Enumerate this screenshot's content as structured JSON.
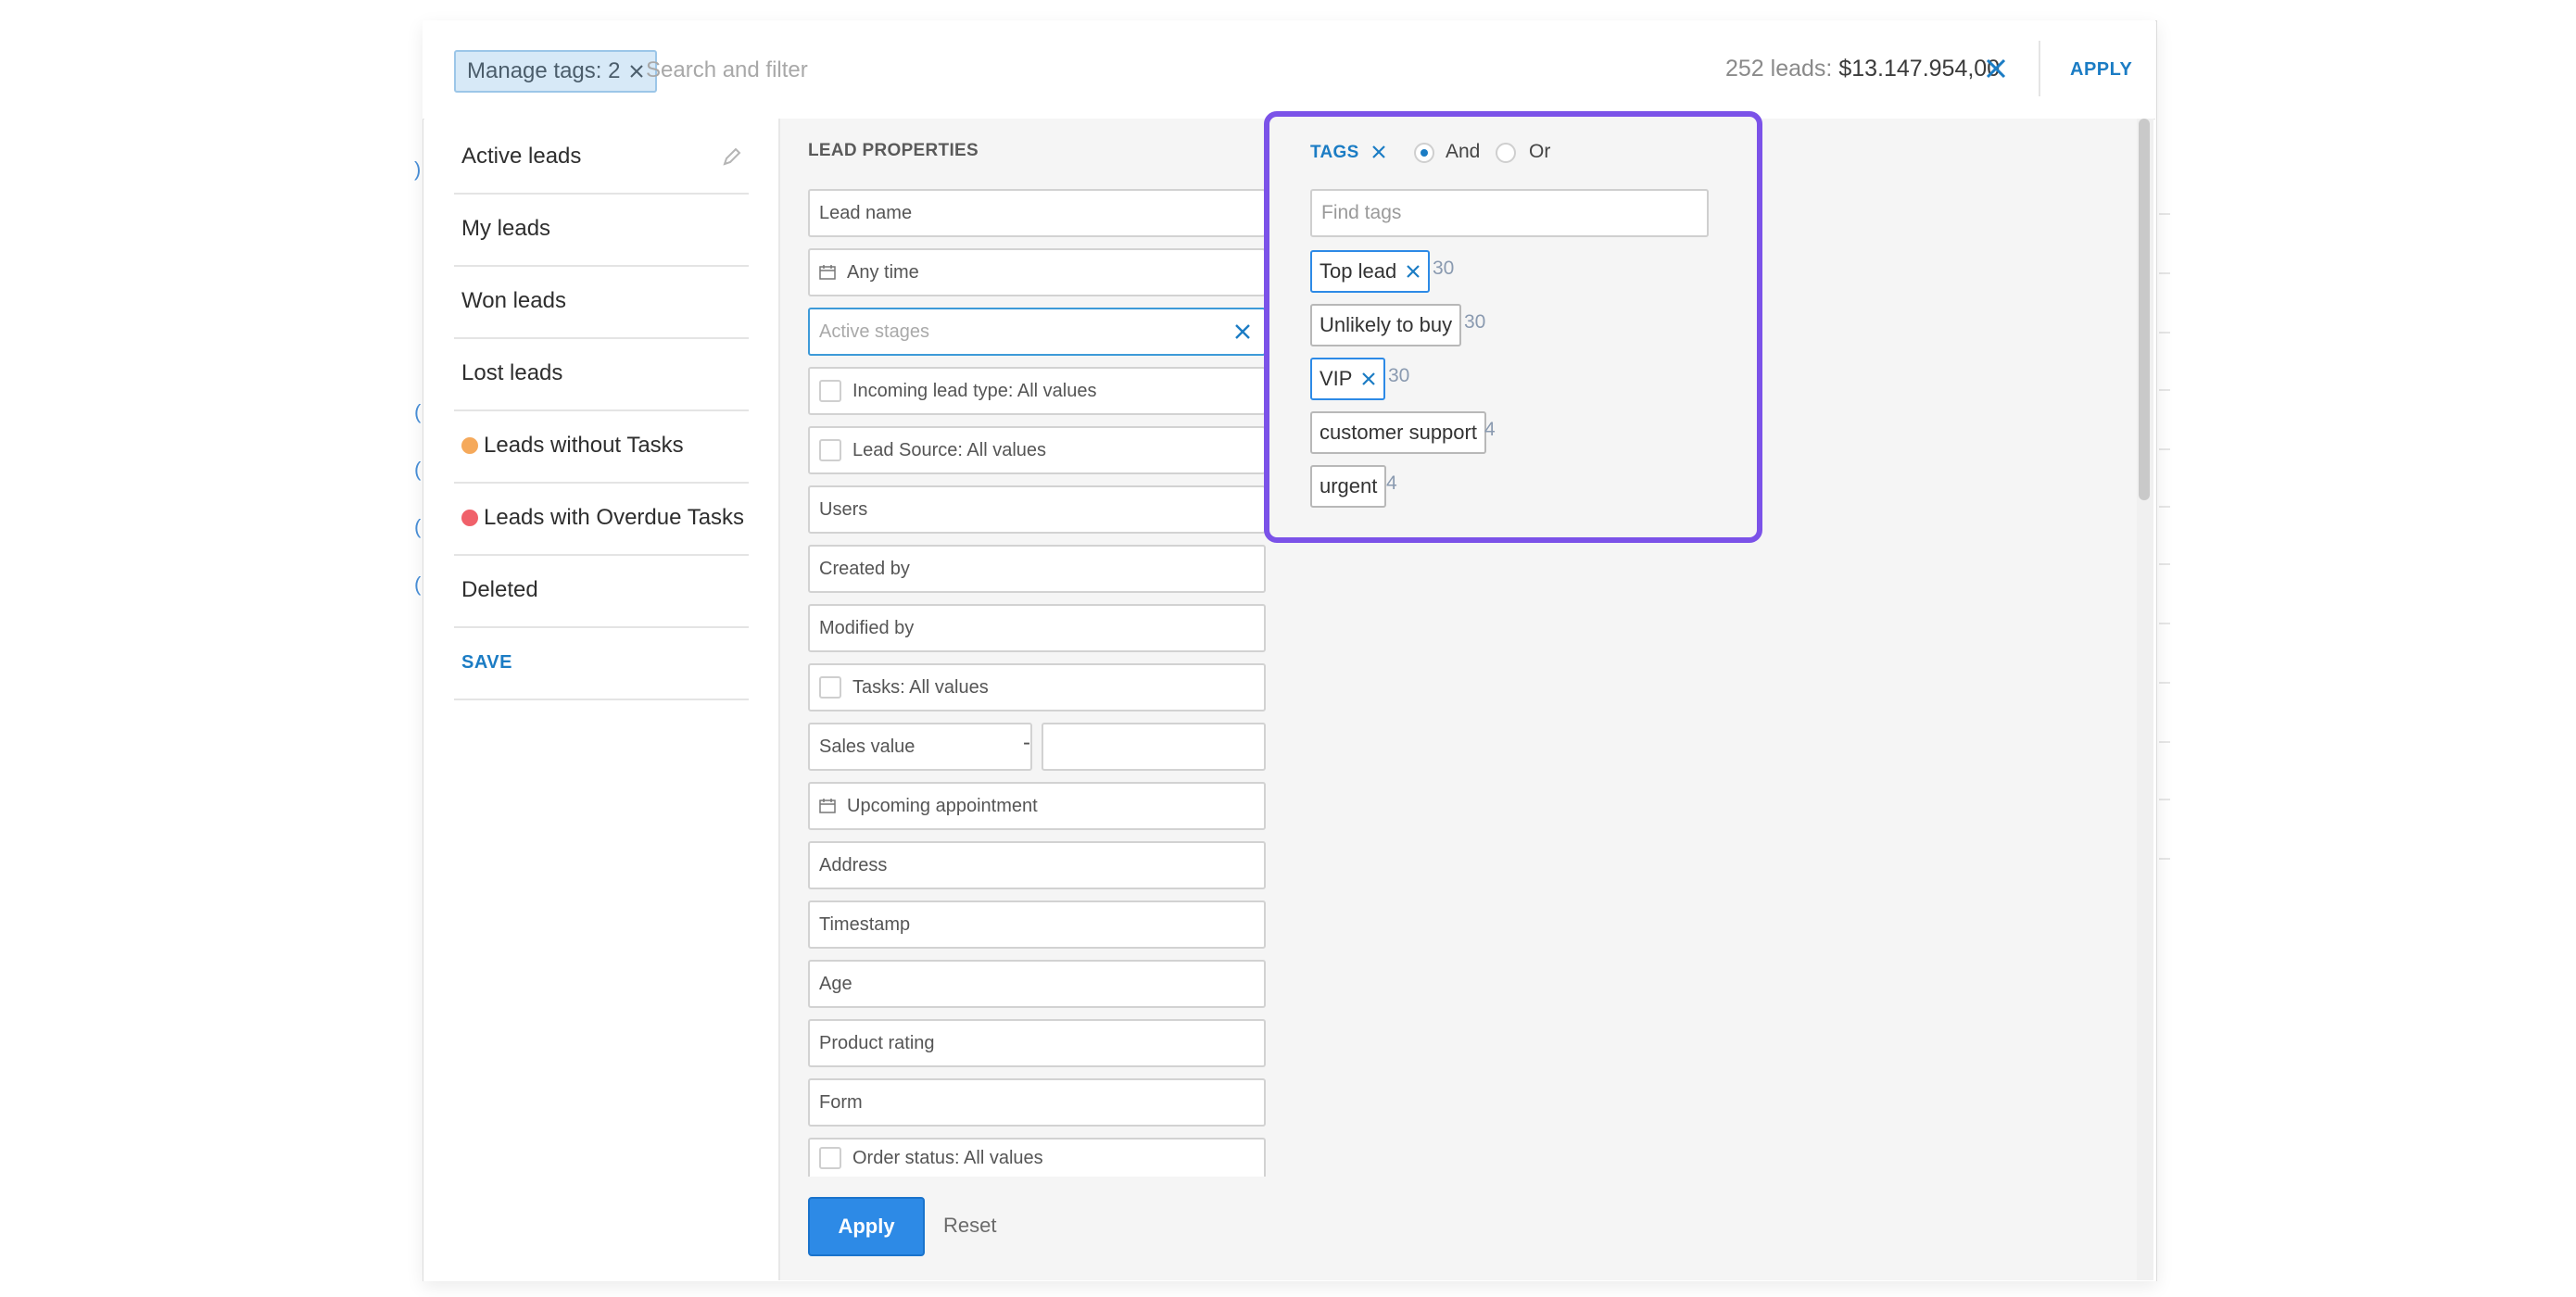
{
  "topbar": {
    "filter_chip": "Manage tags: 2",
    "search_placeholder": "Search and filter",
    "leads_count": "252 leads:",
    "leads_total": "$13.147.954,00",
    "apply_label": "APPLY"
  },
  "sidebar": {
    "items": [
      {
        "label": "Active leads"
      },
      {
        "label": "My leads"
      },
      {
        "label": "Won leads"
      },
      {
        "label": "Lost leads"
      },
      {
        "label": "Leads without Tasks",
        "dot_color": "#f5a95b"
      },
      {
        "label": "Leads with Overdue Tasks",
        "dot_color": "#f0616a"
      },
      {
        "label": "Deleted"
      }
    ],
    "save_label": "SAVE"
  },
  "lead_properties": {
    "title": "LEAD PROPERTIES",
    "fields": {
      "lead_name": "Lead name",
      "any_time": "Any time",
      "active_stages": "Active stages",
      "incoming_lead_type": "Incoming lead type: All values",
      "lead_source": "Lead Source: All values",
      "users": "Users",
      "created_by": "Created by",
      "modified_by": "Modified by",
      "tasks": "Tasks: All values",
      "sales_value": "Sales value",
      "sales_dash": "-",
      "upcoming_appointment": "Upcoming appointment",
      "address": "Address",
      "timestamp": "Timestamp",
      "age": "Age",
      "product_rating": "Product rating",
      "form": "Form",
      "order_status": "Order status: All values"
    },
    "apply_label": "Apply",
    "reset_label": "Reset"
  },
  "tags": {
    "title": "TAGS",
    "and_label": "And",
    "or_label": "Or",
    "selected_mode": "And",
    "find_placeholder": "Find tags",
    "list": [
      {
        "name": "Top lead",
        "count": "30",
        "selected": true
      },
      {
        "name": "Unlikely to buy",
        "count": "30",
        "selected": false
      },
      {
        "name": "VIP",
        "count": "30",
        "selected": true
      },
      {
        "name": "customer support",
        "count": "4",
        "selected": false
      },
      {
        "name": "urgent",
        "count": "4",
        "selected": false
      }
    ]
  },
  "colors": {
    "accent": "#1b7cc4",
    "apply_button": "#2d8ae6",
    "highlight_border": "#7b52e8"
  }
}
